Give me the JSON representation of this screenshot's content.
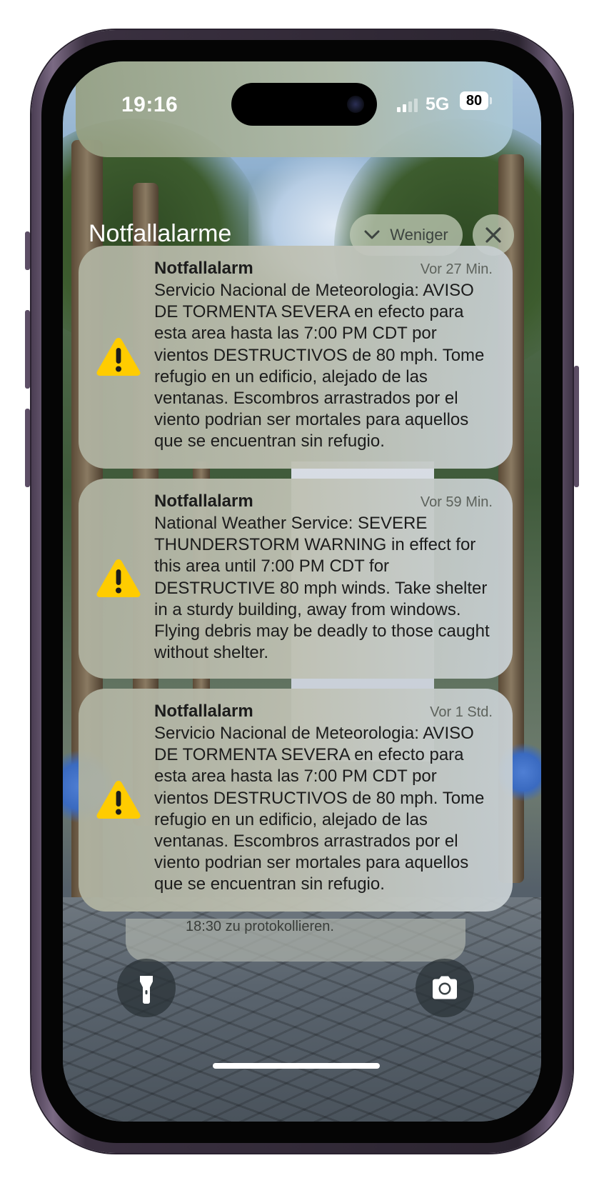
{
  "status_bar": {
    "time": "19:16",
    "network": "5G",
    "battery": "80"
  },
  "group": {
    "title": "Notfallalarme",
    "less_label": "Weniger"
  },
  "notifications": [
    {
      "app": "Notfallalarm",
      "time": "Vor 27 Min.",
      "body": "Servicio Nacional de Meteorologia: AVISO DE TORMENTA SEVERA en efecto para esta area hasta las 7:00 PM CDT por vientos DESTRUCTIVOS de 80 mph. Tome refugio en un edificio, alejado de las ventanas. Escombros arrastrados por el viento podrian ser mortales para aquellos que se encuentran sin refugio.",
      "icon": "warning-icon"
    },
    {
      "app": "Notfallalarm",
      "time": "Vor 59 Min.",
      "body": "National Weather Service: SEVERE THUNDERSTORM WARNING in effect for this area until 7:00 PM CDT for DESTRUCTIVE 80 mph winds. Take shelter in a sturdy building, away from windows. Flying debris may be deadly to those caught without shelter.",
      "icon": "warning-icon"
    },
    {
      "app": "Notfallalarm",
      "time": "Vor 1 Std.",
      "body": "Servicio Nacional de Meteorologia: AVISO DE TORMENTA SEVERA en efecto para esta area hasta las 7:00 PM CDT por vientos DESTRUCTIVOS de 80 mph. Tome refugio en un edificio, alejado de las ventanas. Escombros arrastrados por el viento podrian ser mortales para aquellos que se encuentran sin refugio.",
      "icon": "warning-icon"
    }
  ],
  "stack_peek_text": "18:30 zu protokollieren.",
  "bottom": {
    "left_icon": "flashlight-icon",
    "right_icon": "camera-icon"
  },
  "colors": {
    "warning_yellow": "#FFCC00",
    "text_dark": "#1c1c1c"
  }
}
